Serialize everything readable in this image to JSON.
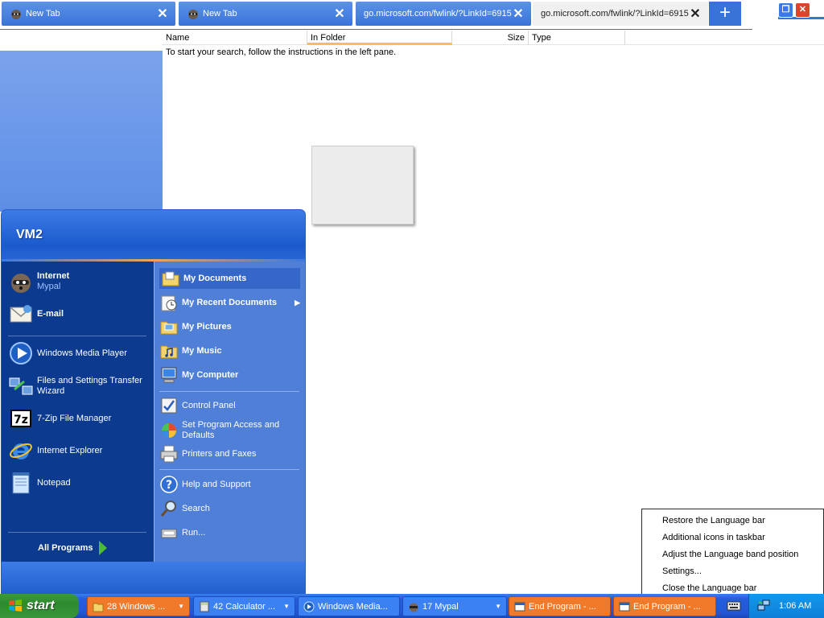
{
  "browser": {
    "tabs": [
      {
        "title": "New Tab",
        "active": false
      },
      {
        "title": "New Tab",
        "active": false
      },
      {
        "title": "go.microsoft.com/fwlink/?LinkId=6915",
        "active": false
      },
      {
        "title": "go.microsoft.com/fwlink/?LinkId=6915",
        "active": true
      }
    ],
    "new_tab_label": "+"
  },
  "explorer": {
    "columns": {
      "name": "Name",
      "in_folder": "In Folder",
      "size": "Size",
      "type": "Type"
    },
    "message": "To start your search, follow the instructions in the left pane."
  },
  "start_menu": {
    "user": "VM2",
    "pinned": [
      {
        "label": "Internet",
        "sub": "Mypal",
        "icon": "mypal-raccoon-icon"
      },
      {
        "label": "E-mail",
        "sub": "",
        "icon": "email-icon"
      }
    ],
    "recent": [
      {
        "label": "Windows Media Player",
        "icon": "windows-media-player-icon"
      },
      {
        "label": "Files and Settings Transfer Wizard",
        "icon": "transfer-wizard-icon"
      },
      {
        "label": "7-Zip File Manager",
        "icon": "7zip-icon"
      },
      {
        "label": "Internet Explorer",
        "icon": "internet-explorer-icon"
      },
      {
        "label": "Notepad",
        "icon": "notepad-icon"
      }
    ],
    "all_programs": "All Programs",
    "places": [
      {
        "label": "My Documents"
      },
      {
        "label": "My Recent Documents"
      },
      {
        "label": "My Pictures"
      },
      {
        "label": "My Music"
      },
      {
        "label": "My Computer"
      }
    ],
    "system": [
      {
        "label": "Control Panel"
      },
      {
        "label": "Set Program Access and Defaults"
      },
      {
        "label": "Printers and Faxes"
      }
    ],
    "help": [
      {
        "label": "Help and Support"
      },
      {
        "label": "Search"
      },
      {
        "label": "Run..."
      }
    ]
  },
  "language_menu": {
    "items": [
      "Restore the Language bar",
      "Additional icons in taskbar",
      "Adjust the Language band position",
      "Settings...",
      "Close the Language bar"
    ]
  },
  "taskbar": {
    "start_label": "start",
    "tasks": [
      {
        "label": "28 Windows ...",
        "style": "orange"
      },
      {
        "label": "42 Calculator ...",
        "style": "blue"
      },
      {
        "label": "Windows Media...",
        "style": "blue"
      },
      {
        "label": "17 Mypal",
        "style": "blue"
      },
      {
        "label": "End Program - ...",
        "style": "orange"
      },
      {
        "label": "End Program - ...",
        "style": "orange"
      }
    ],
    "clock": "1:06 AM"
  },
  "colors": {
    "xp_blue": "#245edb",
    "start_green": "#3c9a3c",
    "taskbar_orange": "#f07a2a",
    "tray_blue": "#0d7fd8"
  }
}
